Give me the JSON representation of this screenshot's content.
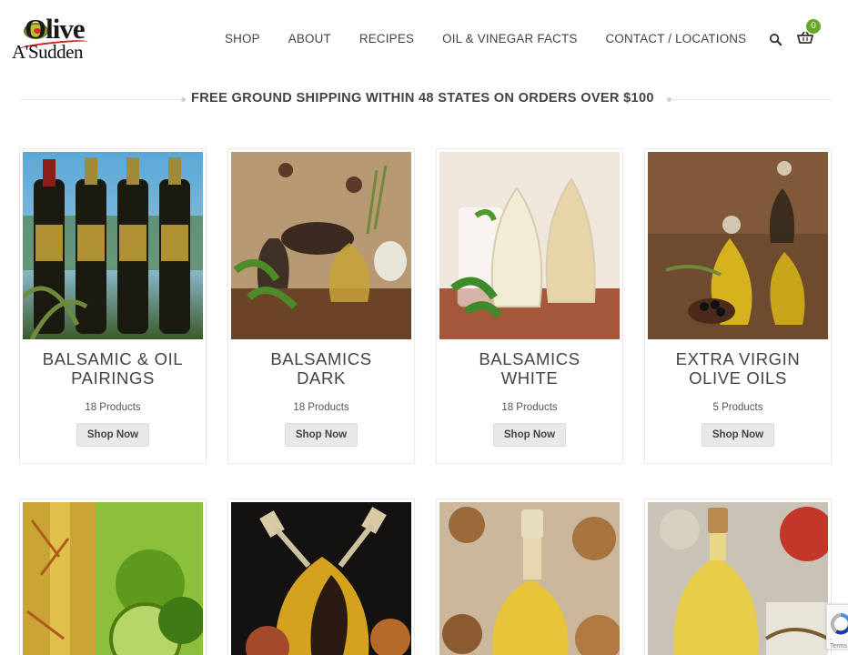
{
  "brand": {
    "logo_top": "Olive",
    "logo_bottom": "A'Sudden"
  },
  "nav": {
    "items": [
      "SHOP",
      "ABOUT",
      "RECIPES",
      "OIL & VINEGAR FACTS",
      "CONTACT / LOCATIONS"
    ]
  },
  "cart": {
    "count": "0"
  },
  "banner": {
    "text": "FREE GROUND SHIPPING WITHIN 48 STATES ON ORDERS OVER $100"
  },
  "categories": [
    {
      "title_line1": "BALSAMIC & OIL",
      "title_line2": "PAIRINGS",
      "count": "18 Products",
      "button": "Shop Now"
    },
    {
      "title_line1": "BALSAMICS",
      "title_line2": "DARK",
      "count": "18 Products",
      "button": "Shop Now"
    },
    {
      "title_line1": "BALSAMICS",
      "title_line2": "WHITE",
      "count": "18 Products",
      "button": "Shop Now"
    },
    {
      "title_line1": "EXTRA VIRGIN",
      "title_line2": "OLIVE OILS",
      "count": "5 Products",
      "button": "Shop Now"
    }
  ],
  "recaptcha": {
    "terms": "- Terms"
  }
}
